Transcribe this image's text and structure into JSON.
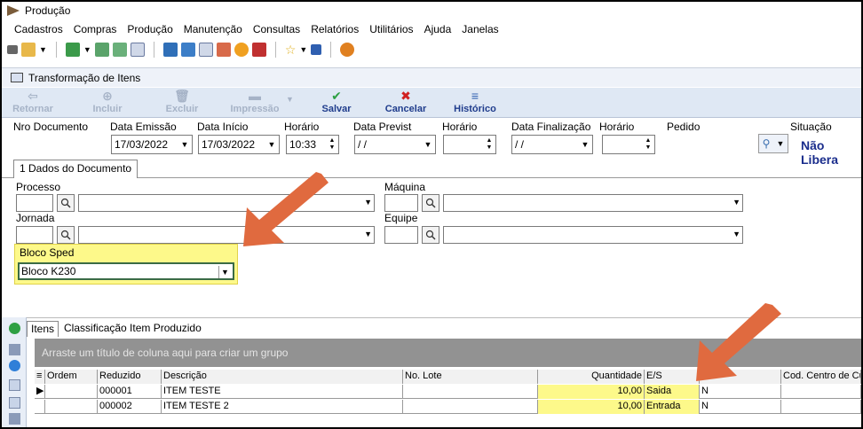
{
  "window": {
    "title": "Produção"
  },
  "menu": [
    "Cadastros",
    "Compras",
    "Produção",
    "Manutenção",
    "Consultas",
    "Relatórios",
    "Utilitários",
    "Ajuda",
    "Janelas"
  ],
  "form": {
    "title": "Transformação de Itens"
  },
  "toolbar": {
    "retornar": "Retornar",
    "incluir": "Incluir",
    "excluir": "Excluir",
    "impressao": "Impressão",
    "salvar": "Salvar",
    "cancelar": "Cancelar",
    "historico": "Histórico"
  },
  "header": {
    "labels": {
      "nro_documento": "Nro Documento",
      "data_emissao": "Data Emissão",
      "data_inicio": "Data Início",
      "horario1": "Horário",
      "data_previst": "Data Previst",
      "horario2": "Horário",
      "data_finalizacao": "Data Finalização",
      "horario3": "Horário",
      "pedido": "Pedido",
      "situacao": "Situação"
    },
    "data_emissao": "17/03/2022",
    "data_inicio": "17/03/2022",
    "horario1": "10:33",
    "data_previst": "/ /",
    "data_finalizacao": "/ /",
    "situacao": "Não Libera"
  },
  "tab": "1 Dados do Documento",
  "fields": {
    "processo": "Processo",
    "maquina": "Máquina",
    "jornada": "Jornada",
    "equipe": "Equipe",
    "bloco_sped_label": "Bloco Sped",
    "bloco_sped_value": "Bloco K230"
  },
  "items_tabs": [
    "Itens",
    "Classificação Item Produzido"
  ],
  "group_hint": "Arraste um título de coluna aqui para criar um grupo",
  "grid": {
    "columns": [
      "Ordem",
      "Reduzido",
      "Descrição",
      "No. Lote",
      "Quantidade",
      "E/S",
      "",
      "Cod. Centro de Cus"
    ],
    "rows": [
      {
        "reduzido": "000001",
        "descricao": "ITEM TESTE",
        "quantidade": "10,00",
        "es": "Saida",
        "col7": "N"
      },
      {
        "reduzido": "000002",
        "descricao": "ITEM TESTE 2",
        "quantidade": "10,00",
        "es": "Entrada",
        "col7": "N"
      }
    ]
  },
  "colors": {
    "highlight": "#fdf98a",
    "arrow": "#e06a3f",
    "accent": "#1f3c8c"
  }
}
